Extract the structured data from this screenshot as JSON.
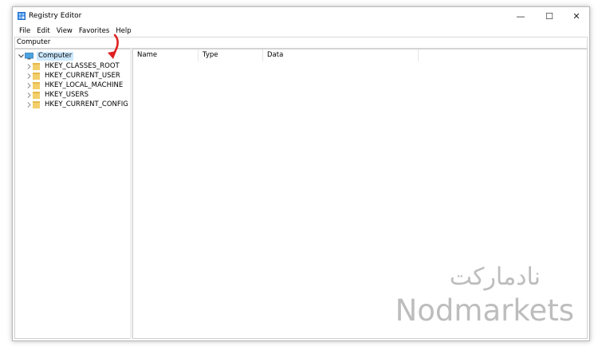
{
  "window": {
    "title": "Registry Editor",
    "controls": {
      "minimize": "—",
      "maximize": "☐",
      "close": "✕"
    }
  },
  "menu": [
    "File",
    "Edit",
    "View",
    "Favorites",
    "Help"
  ],
  "address_bar": {
    "value": "Computer"
  },
  "tree": {
    "root": {
      "label": "Computer",
      "expanded": true,
      "selected": true
    },
    "hives": [
      {
        "label": "HKEY_CLASSES_ROOT"
      },
      {
        "label": "HKEY_CURRENT_USER"
      },
      {
        "label": "HKEY_LOCAL_MACHINE"
      },
      {
        "label": "HKEY_USERS"
      },
      {
        "label": "HKEY_CURRENT_CONFIG"
      }
    ]
  },
  "list": {
    "columns": [
      "Name",
      "Type",
      "Data"
    ]
  },
  "watermark": {
    "arabic": "نادمارکت",
    "latin": "Nodmarkets"
  },
  "colors": {
    "selection": "#cce8ff",
    "folder": "#f2cf6b",
    "arrow": "#e02020",
    "watermark": "#bdbdbd"
  }
}
